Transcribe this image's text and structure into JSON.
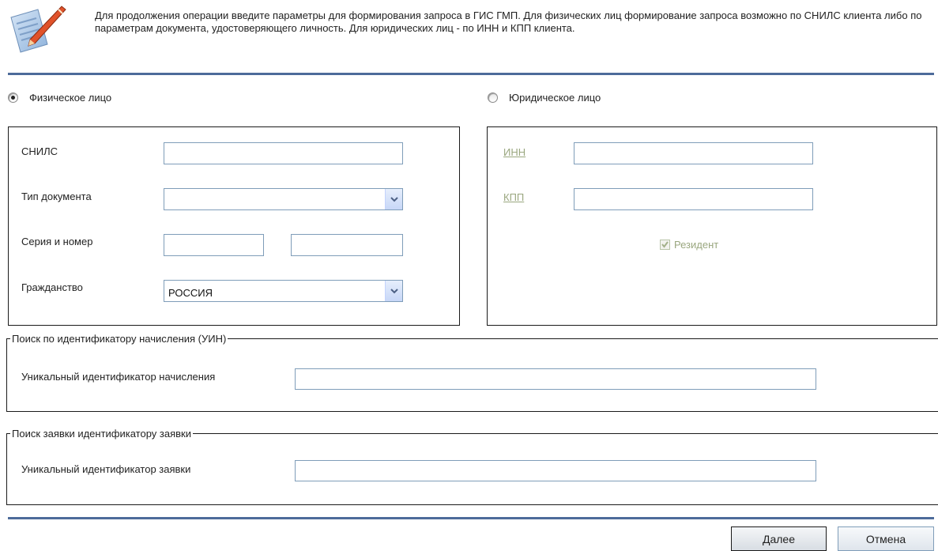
{
  "header": {
    "description": "Для продолжения операции введите параметры для формирования запроса в ГИС ГМП. Для физических лиц формирование запроса возможно по СНИЛС клиента либо по параметрам документа, удостоверяющего личность. Для юридических лиц - по ИНН и КПП клиента."
  },
  "person_type": {
    "individual_label": "Физическое лицо",
    "legal_label": "Юридическое лицо",
    "selected": "individual"
  },
  "individual": {
    "snils_label": "СНИЛС",
    "snils_value": "",
    "doc_type_label": "Тип документа",
    "doc_type_value": "",
    "series_number_label": "Серия и номер",
    "series_value": "",
    "number_value": "",
    "citizenship_label": "Гражданство",
    "citizenship_value": "РОССИЯ"
  },
  "legal": {
    "inn_label": "ИНН",
    "inn_value": "",
    "kpp_label": "КПП",
    "kpp_value": "",
    "resident_label": "Резидент",
    "resident_checked": true
  },
  "uin_search": {
    "legend": "Поиск по идентификатору начисления (УИН)",
    "field_label": "Уникальный идентификатор начисления",
    "field_value": ""
  },
  "request_search": {
    "legend": "Поиск заявки идентификатору заявки",
    "field_label": "Уникальный идентификатор заявки",
    "field_value": ""
  },
  "buttons": {
    "next": "Далее",
    "cancel": "Отмена"
  }
}
